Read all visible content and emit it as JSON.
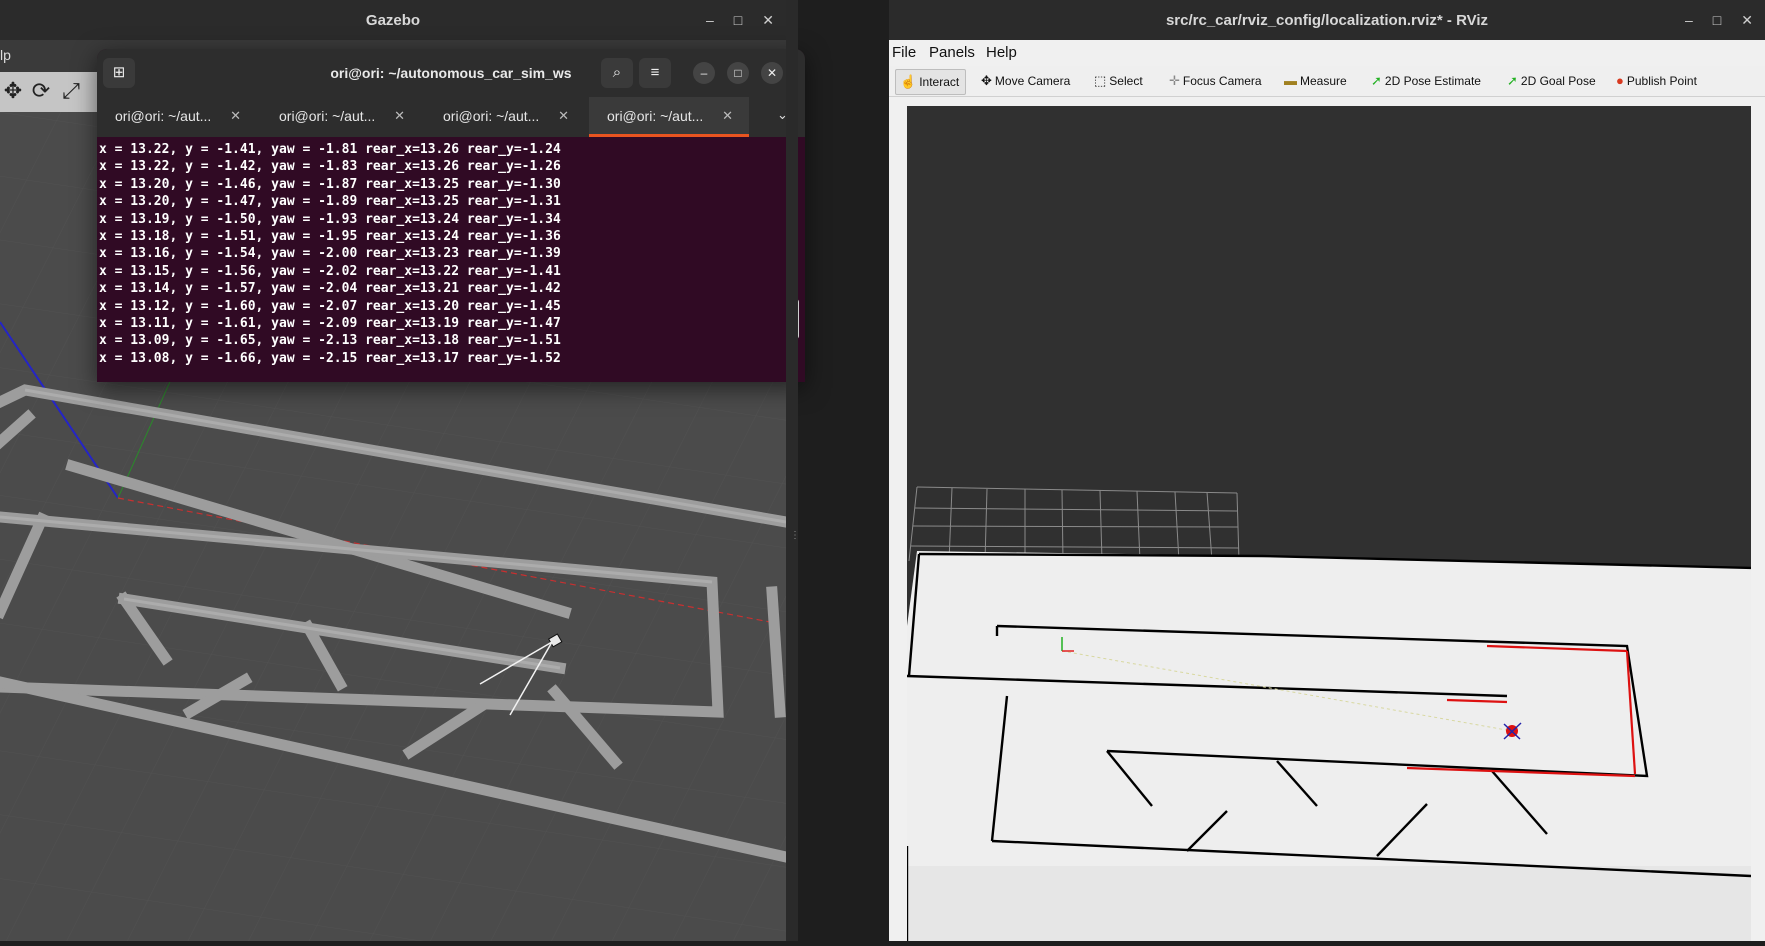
{
  "gazebo": {
    "title": "Gazebo",
    "menu_fragment": "lp",
    "controls": {
      "min": "–",
      "max": "□",
      "close": "✕"
    }
  },
  "terminal": {
    "title": "ori@ori: ~/autonomous_car_sim_ws",
    "tabs": [
      {
        "label": "ori@ori: ~/aut..."
      },
      {
        "label": "ori@ori: ~/aut..."
      },
      {
        "label": "ori@ori: ~/aut..."
      },
      {
        "label": "ori@ori: ~/aut..."
      }
    ],
    "lines": [
      "x = 13.22, y = -1.41, yaw = -1.81 rear_x=13.26 rear_y=-1.24",
      "x = 13.22, y = -1.42, yaw = -1.83 rear_x=13.26 rear_y=-1.26",
      "x = 13.20, y = -1.46, yaw = -1.87 rear_x=13.25 rear_y=-1.30",
      "x = 13.20, y = -1.47, yaw = -1.89 rear_x=13.25 rear_y=-1.31",
      "x = 13.19, y = -1.50, yaw = -1.93 rear_x=13.24 rear_y=-1.34",
      "x = 13.18, y = -1.51, yaw = -1.95 rear_x=13.24 rear_y=-1.36",
      "x = 13.16, y = -1.54, yaw = -2.00 rear_x=13.23 rear_y=-1.39",
      "x = 13.15, y = -1.56, yaw = -2.02 rear_x=13.22 rear_y=-1.41",
      "x = 13.14, y = -1.57, yaw = -2.04 rear_x=13.21 rear_y=-1.42",
      "x = 13.12, y = -1.60, yaw = -2.07 rear_x=13.20 rear_y=-1.45",
      "x = 13.11, y = -1.61, yaw = -2.09 rear_x=13.19 rear_y=-1.47",
      "x = 13.09, y = -1.65, yaw = -2.13 rear_x=13.18 rear_y=-1.51",
      "x = 13.08, y = -1.66, yaw = -2.15 rear_x=13.17 rear_y=-1.52"
    ],
    "colors": {
      "background": "#300a24",
      "active_tab_accent": "#e95420"
    }
  },
  "rviz": {
    "title": "src/rc_car/rviz_config/localization.rviz* - RViz",
    "menu": {
      "file": "File",
      "panels": "Panels",
      "help": "Help"
    },
    "tools": {
      "interact": "Interact",
      "move_camera": "Move Camera",
      "select": "Select",
      "focus_camera": "Focus Camera",
      "measure": "Measure",
      "pose_estimate": "2D Pose Estimate",
      "goal_pose": "2D Goal Pose",
      "publish_point": "Publish Point"
    }
  }
}
